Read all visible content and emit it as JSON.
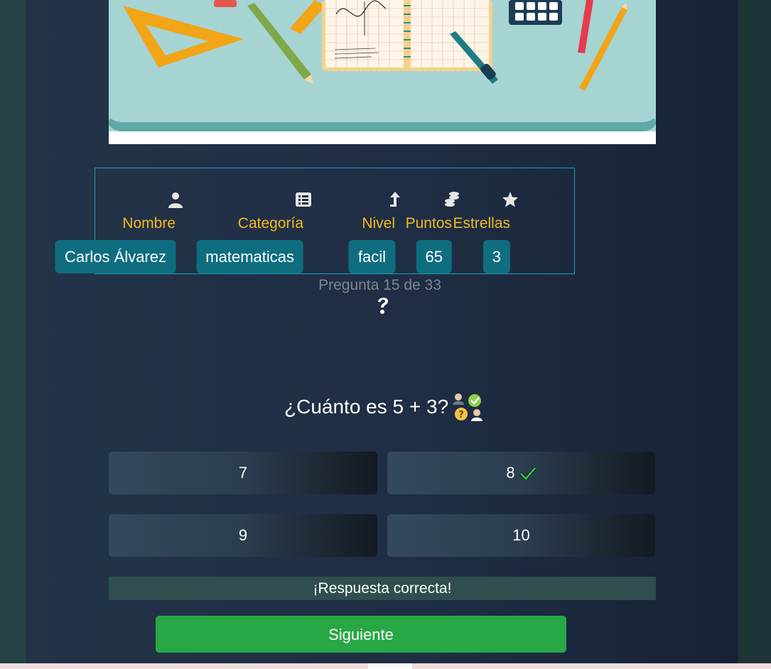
{
  "stats": {
    "name": {
      "icon": "user-icon",
      "label": "Nombre",
      "value": "Carlos Álvarez"
    },
    "category": {
      "icon": "list-icon",
      "label": "Categoría",
      "value": "matematicas"
    },
    "level": {
      "icon": "level-up-icon",
      "label": "Nivel",
      "value": "facil"
    },
    "points": {
      "icon": "coins-icon",
      "label": "Puntos",
      "value": "65"
    },
    "stars": {
      "icon": "star-icon",
      "label": "Estrellas",
      "value": "3"
    }
  },
  "progress": "Pregunta 15 de 33",
  "question": {
    "text": "¿Cuánto es 5 + 3?",
    "icon": "quiz-people-icon"
  },
  "answers": [
    {
      "label": "7",
      "correct": false
    },
    {
      "label": "8",
      "correct": true
    },
    {
      "label": "9",
      "correct": false
    },
    {
      "label": "10",
      "correct": false
    }
  ],
  "feedback": "¡Respuesta correcta!",
  "next_label": "Siguiente",
  "colors": {
    "accent_label": "#f5b921",
    "badge": "#0f6d80",
    "frame": "#17a2b8",
    "next_button": "#28a745",
    "check": "#2ecc40"
  }
}
